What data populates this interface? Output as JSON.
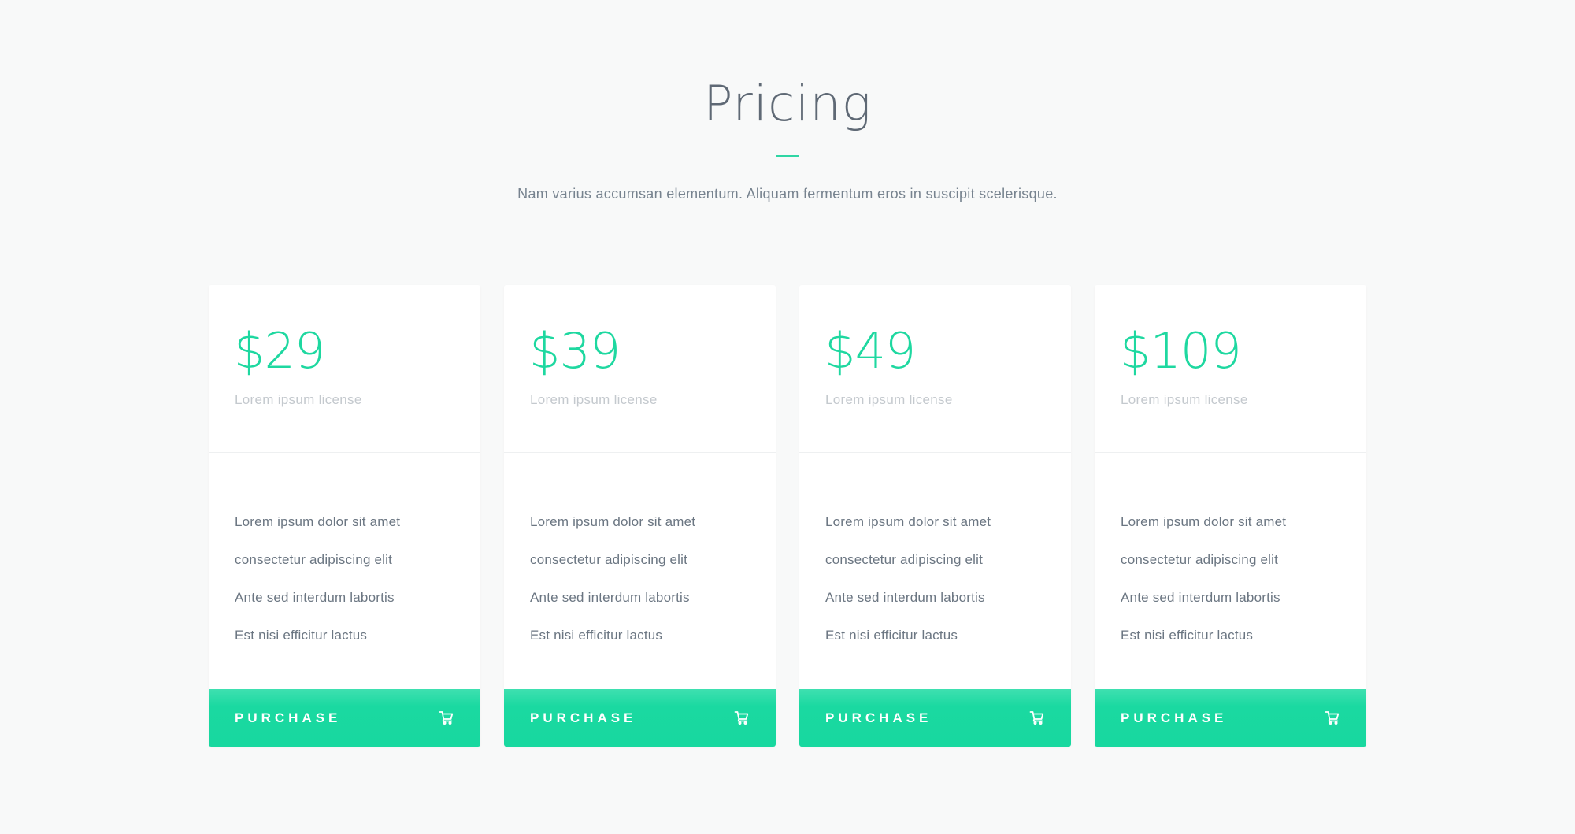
{
  "header": {
    "title": "Pricing",
    "subtitle": "Nam varius accumsan elementum. Aliquam fermentum eros in suscipit scelerisque."
  },
  "colors": {
    "accent": "#1ed8a0",
    "background": "#f8f9f9",
    "card": "#ffffff",
    "text": "#6b7682"
  },
  "plans": [
    {
      "price": "$29",
      "license": "Lorem ipsum license",
      "features": [
        "Lorem ipsum dolor sit amet",
        "consectetur adipiscing elit",
        "Ante sed interdum labortis",
        "Est nisi efficitur lactus"
      ],
      "button_label": "PURCHASE",
      "button_icon": "cart-icon"
    },
    {
      "price": "$39",
      "license": "Lorem ipsum license",
      "features": [
        "Lorem ipsum dolor sit amet",
        "consectetur adipiscing elit",
        "Ante sed interdum labortis",
        "Est nisi efficitur lactus"
      ],
      "button_label": "PURCHASE",
      "button_icon": "cart-icon"
    },
    {
      "price": "$49",
      "license": "Lorem ipsum license",
      "features": [
        "Lorem ipsum dolor sit amet",
        "consectetur adipiscing elit",
        "Ante sed interdum labortis",
        "Est nisi efficitur lactus"
      ],
      "button_label": "PURCHASE",
      "button_icon": "cart-icon"
    },
    {
      "price": "$109",
      "license": "Lorem ipsum license",
      "features": [
        "Lorem ipsum dolor sit amet",
        "consectetur adipiscing elit",
        "Ante sed interdum labortis",
        "Est nisi efficitur lactus"
      ],
      "button_label": "PURCHASE",
      "button_icon": "cart-icon"
    }
  ]
}
